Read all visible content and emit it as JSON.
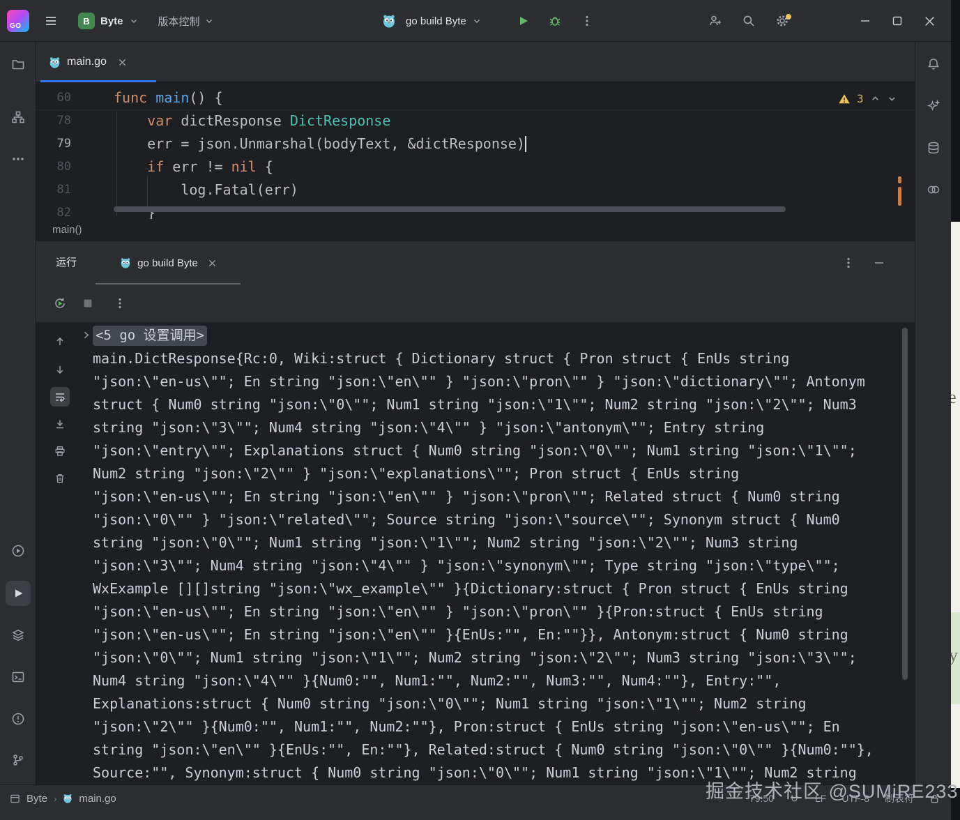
{
  "titlebar": {
    "logo": "GO",
    "project": {
      "badge": "B",
      "name": "Byte"
    },
    "vcs": "版本控制",
    "run_config": "go build Byte"
  },
  "editor": {
    "tab": "main.go",
    "inspections": {
      "warnings": "3"
    },
    "breadcrumb": "main()",
    "code": [
      {
        "n": "60",
        "current": false,
        "caret": false,
        "tokens": [
          [
            "kw",
            "func "
          ],
          [
            "fn",
            "main"
          ],
          [
            "pl",
            "() {"
          ]
        ]
      },
      {
        "n": "78",
        "current": false,
        "caret": false,
        "tokens": [
          [
            "pl",
            "    "
          ],
          [
            "kw",
            "var "
          ],
          [
            "pl",
            "dictResponse "
          ],
          [
            "ty",
            "DictResponse"
          ]
        ]
      },
      {
        "n": "79",
        "current": true,
        "caret": true,
        "tokens": [
          [
            "pl",
            "    err = json.Unmarshal(bodyText, &dictResponse)"
          ]
        ]
      },
      {
        "n": "80",
        "current": false,
        "caret": false,
        "tokens": [
          [
            "pl",
            "    "
          ],
          [
            "kw",
            "if "
          ],
          [
            "pl",
            "err != "
          ],
          [
            "kw",
            "nil "
          ],
          [
            "pl",
            "{"
          ]
        ]
      },
      {
        "n": "81",
        "current": false,
        "caret": false,
        "tokens": [
          [
            "pl",
            "        log.Fatal(err)"
          ]
        ]
      },
      {
        "n": "82",
        "current": false,
        "caret": false,
        "tokens": [
          [
            "pl",
            "    }"
          ]
        ]
      }
    ]
  },
  "run": {
    "tool_title": "运行",
    "tab": "go build Byte",
    "fold": "<5 go 设置调用>",
    "console": [
      "main.DictResponse{Rc:0, Wiki:struct { Dictionary struct { Pron struct { EnUs string",
      "\"json:\\\"en-us\\\"\"; En string \"json:\\\"en\\\"\" } \"json:\\\"pron\\\"\" } \"json:\\\"dictionary\\\"\"; Antonym",
      "struct { Num0 string \"json:\\\"0\\\"\"; Num1 string \"json:\\\"1\\\"\"; Num2 string \"json:\\\"2\\\"\"; Num3",
      "string \"json:\\\"3\\\"\"; Num4 string \"json:\\\"4\\\"\" } \"json:\\\"antonym\\\"\"; Entry string",
      "\"json:\\\"entry\\\"\"; Explanations struct { Num0 string \"json:\\\"0\\\"\"; Num1 string \"json:\\\"1\\\"\";",
      "Num2 string \"json:\\\"2\\\"\" } \"json:\\\"explanations\\\"\"; Pron struct { EnUs string",
      "\"json:\\\"en-us\\\"\"; En string \"json:\\\"en\\\"\" } \"json:\\\"pron\\\"\"; Related struct { Num0 string",
      "\"json:\\\"0\\\"\" } \"json:\\\"related\\\"\"; Source string \"json:\\\"source\\\"\"; Synonym struct { Num0",
      "string \"json:\\\"0\\\"\"; Num1 string \"json:\\\"1\\\"\"; Num2 string \"json:\\\"2\\\"\"; Num3 string",
      "\"json:\\\"3\\\"\"; Num4 string \"json:\\\"4\\\"\" } \"json:\\\"synonym\\\"\"; Type string \"json:\\\"type\\\"\";",
      "WxExample [][]string \"json:\\\"wx_example\\\"\" }{Dictionary:struct { Pron struct { EnUs string",
      "\"json:\\\"en-us\\\"\"; En string \"json:\\\"en\\\"\" } \"json:\\\"pron\\\"\" }{Pron:struct { EnUs string",
      "\"json:\\\"en-us\\\"\"; En string \"json:\\\"en\\\"\" }{EnUs:\"\", En:\"\"}}, Antonym:struct { Num0 string",
      "\"json:\\\"0\\\"\"; Num1 string \"json:\\\"1\\\"\"; Num2 string \"json:\\\"2\\\"\"; Num3 string \"json:\\\"3\\\"\";",
      "Num4 string \"json:\\\"4\\\"\" }{Num0:\"\", Num1:\"\", Num2:\"\", Num3:\"\", Num4:\"\"}, Entry:\"\",",
      "Explanations:struct { Num0 string \"json:\\\"0\\\"\"; Num1 string \"json:\\\"1\\\"\"; Num2 string",
      "\"json:\\\"2\\\"\" }{Num0:\"\", Num1:\"\", Num2:\"\"}, Pron:struct { EnUs string \"json:\\\"en-us\\\"\"; En",
      "string \"json:\\\"en\\\"\" }{EnUs:\"\", En:\"\"}, Related:struct { Num0 string \"json:\\\"0\\\"\" }{Num0:\"\"},",
      "Source:\"\", Synonym:struct { Num0 string \"json:\\\"0\\\"\"; Num1 string \"json:\\\"1\\\"\"; Num2 string"
    ]
  },
  "statusbar": {
    "project": "Byte",
    "file": "main.go",
    "caret": "79:50",
    "line_sep": "LF",
    "encoding": "UTF-8",
    "indent": "制表符"
  },
  "watermark": {
    "text": "掘金技术社区 @SUMiRE233"
  }
}
